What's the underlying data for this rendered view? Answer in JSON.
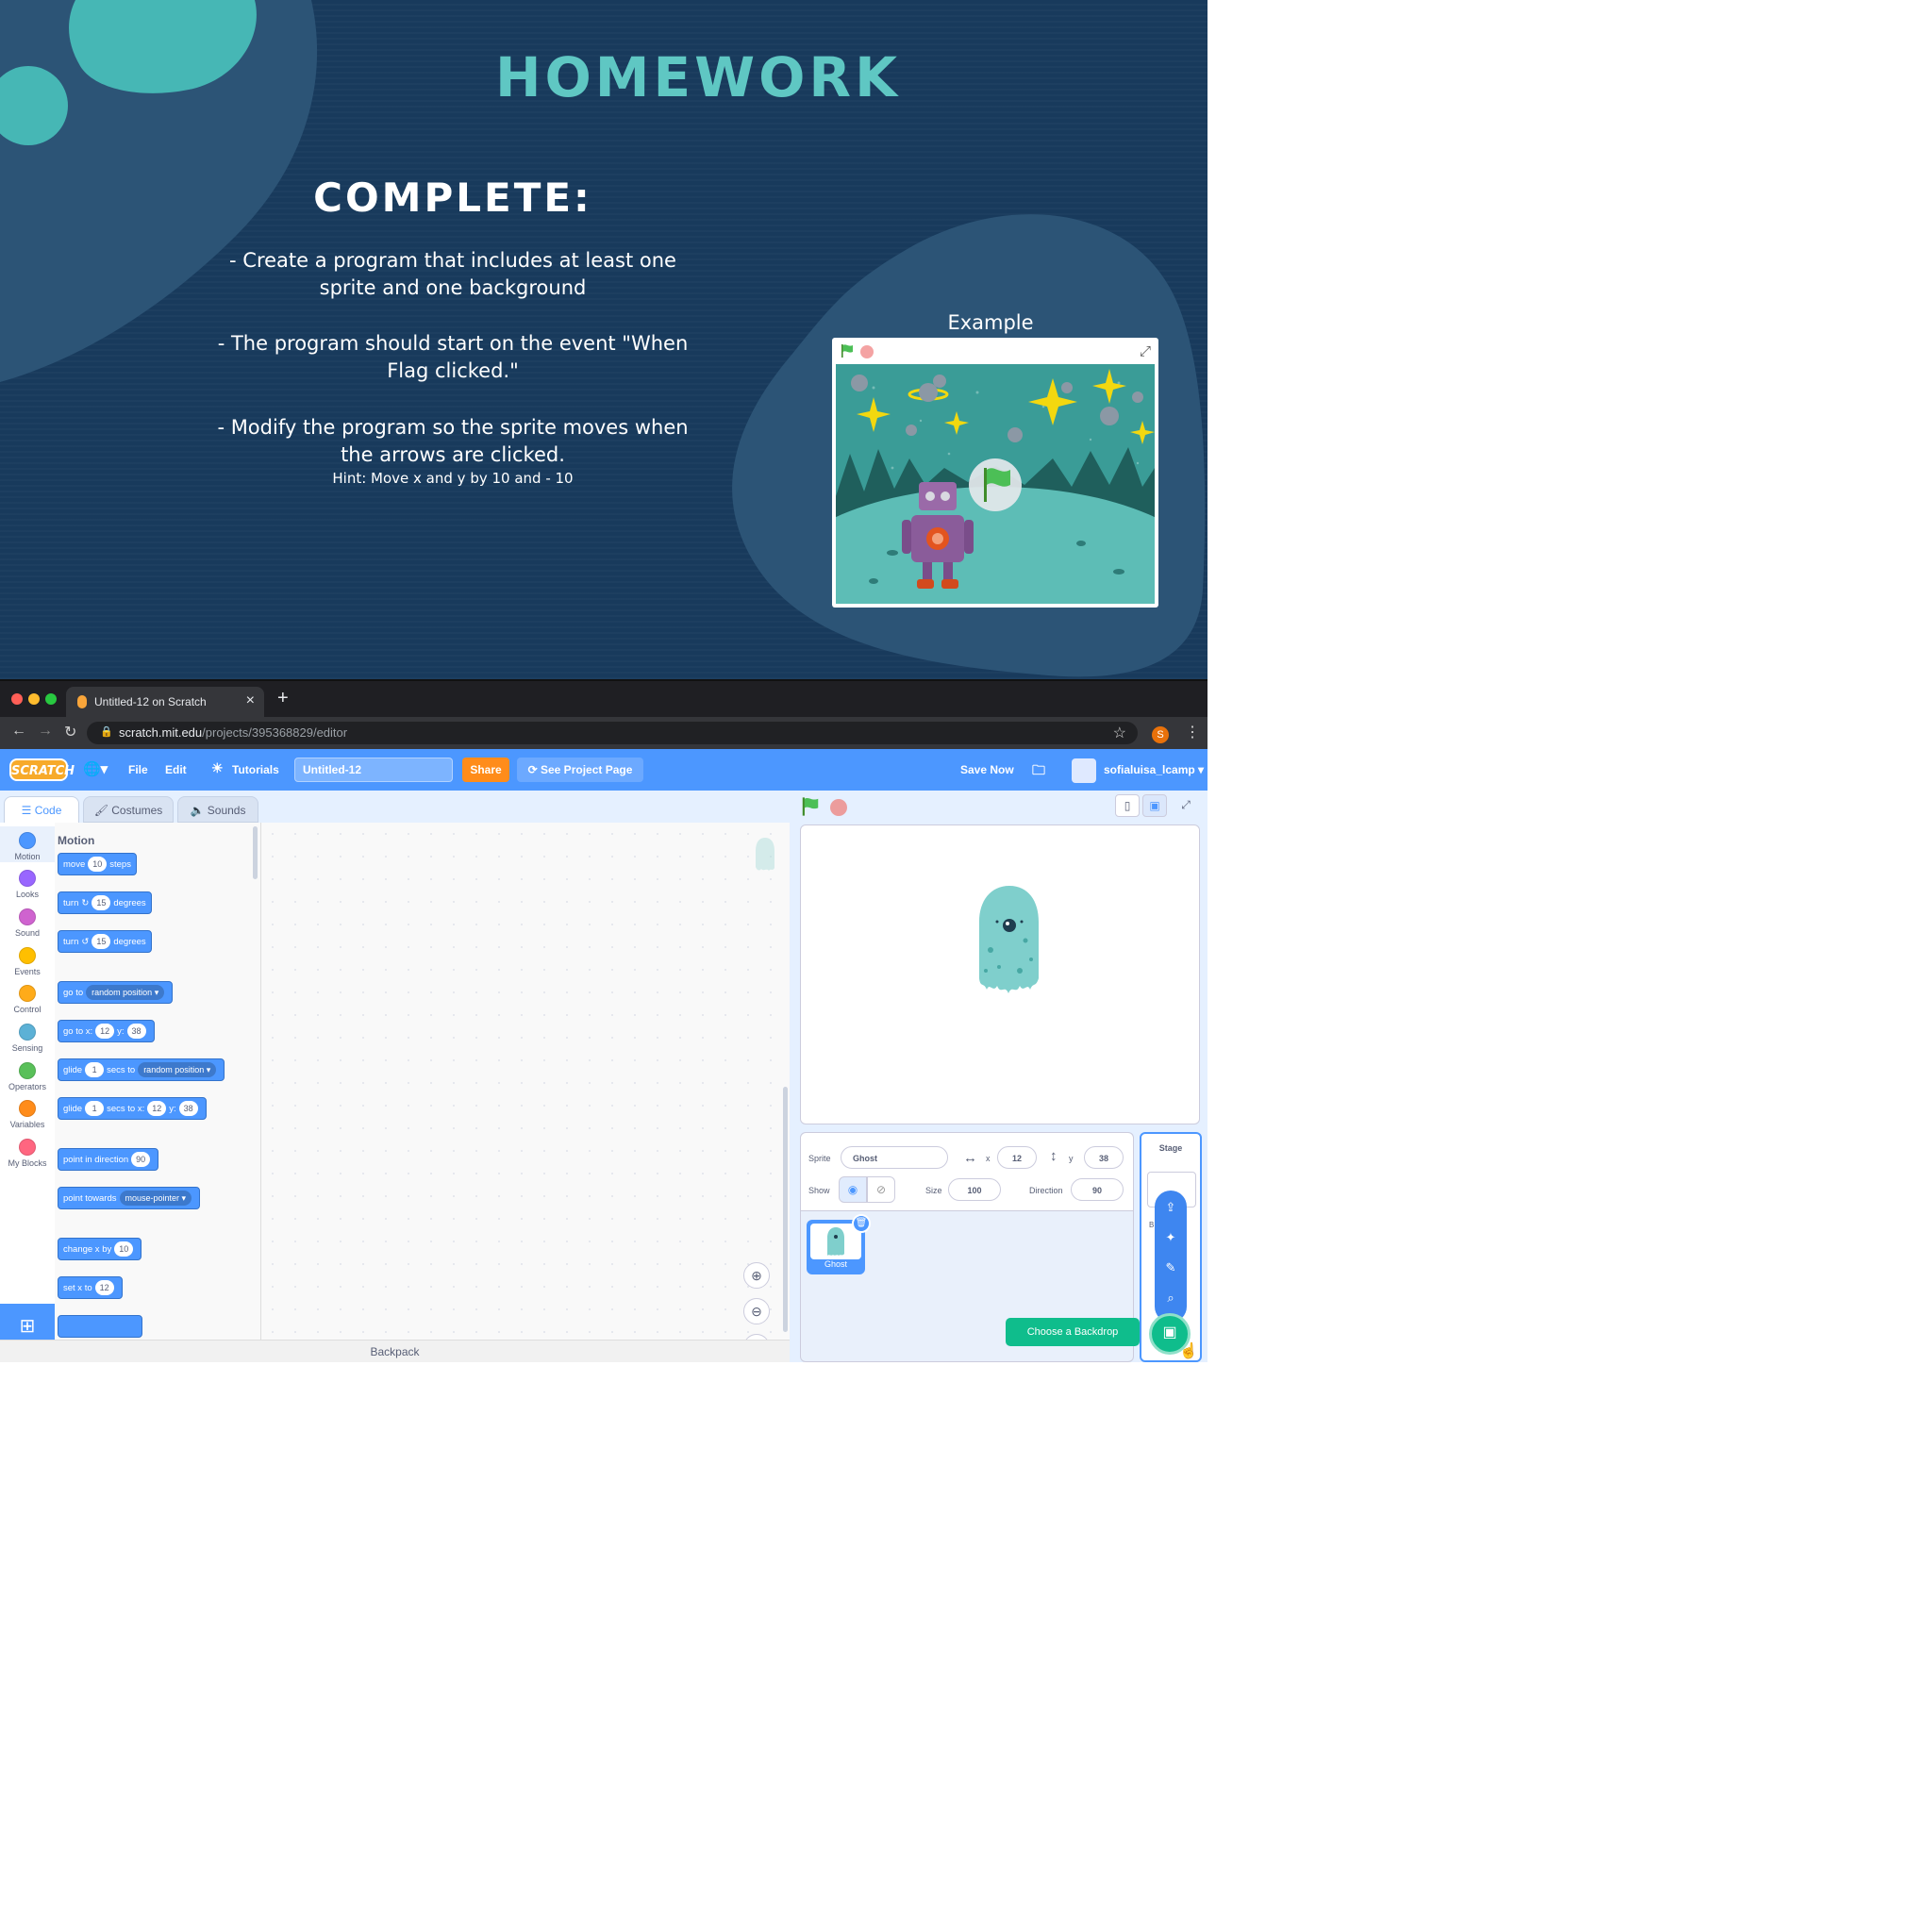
{
  "slide": {
    "title": "HOMEWORK",
    "heading": "COMPLETE:",
    "bullets": [
      "- Create a program that includes at least one sprite and one background",
      "- The program should start on the event \"When Flag clicked.\"",
      "- Modify the program so the sprite moves when the arrows are clicked."
    ],
    "hint": "Hint: Move x and y by 10 and - 10",
    "example_label": "Example",
    "colors": {
      "background": "#183a5c",
      "accent": "#5fc7c3",
      "blob": "#2c5476"
    }
  },
  "browser": {
    "tab_title": "Untitled-12 on Scratch",
    "url_host": "scratch.mit.edu",
    "url_path": "/projects/395368829/editor",
    "profile_initial": "S"
  },
  "menubar": {
    "logo": "SCRATCH",
    "file": "File",
    "edit": "Edit",
    "tutorials": "Tutorials",
    "project_title": "Untitled-12",
    "share": "Share",
    "see_project_page": "See Project Page",
    "save_now": "Save Now",
    "username": "sofialuisa_lcamp"
  },
  "editor_tabs": {
    "code": "Code",
    "costumes": "Costumes",
    "sounds": "Sounds"
  },
  "categories": [
    {
      "label": "Motion",
      "color": "#4c97ff"
    },
    {
      "label": "Looks",
      "color": "#9966ff"
    },
    {
      "label": "Sound",
      "color": "#cf63cf"
    },
    {
      "label": "Events",
      "color": "#ffbf00"
    },
    {
      "label": "Control",
      "color": "#ffab19"
    },
    {
      "label": "Sensing",
      "color": "#5cb1d6"
    },
    {
      "label": "Operators",
      "color": "#59c059"
    },
    {
      "label": "Variables",
      "color": "#ff8c1a"
    },
    {
      "label": "My Blocks",
      "color": "#ff6680"
    }
  ],
  "palette": {
    "heading": "Motion",
    "move": {
      "a": "move",
      "n": "10",
      "b": "steps"
    },
    "turn_right": {
      "a": "turn",
      "n": "15",
      "b": "degrees"
    },
    "turn_left": {
      "a": "turn",
      "n": "15",
      "b": "degrees"
    },
    "goto_random": {
      "a": "go to",
      "dd": "random position"
    },
    "goto_xy": {
      "a": "go to x:",
      "x": "12",
      "b": "y:",
      "y": "38"
    },
    "glide_random": {
      "a": "glide",
      "n": "1",
      "b": "secs to",
      "dd": "random position"
    },
    "glide_xy": {
      "a": "glide",
      "n": "1",
      "b": "secs to x:",
      "x": "12",
      "c": "y:",
      "y": "38"
    },
    "point_dir": {
      "a": "point in direction",
      "n": "90"
    },
    "point_towards": {
      "a": "point towards",
      "dd": "mouse-pointer"
    },
    "change_x": {
      "a": "change x by",
      "n": "10"
    },
    "set_x": {
      "a": "set x to",
      "n": "12"
    }
  },
  "backpack": "Backpack",
  "sprite_info": {
    "sprite_label": "Sprite",
    "sprite_name": "Ghost",
    "x_label": "x",
    "x": "12",
    "y_label": "y",
    "y": "38",
    "show_label": "Show",
    "size_label": "Size",
    "size": "100",
    "direction_label": "Direction",
    "direction": "90"
  },
  "sprite_tile_name": "Ghost",
  "stage_pane": {
    "title": "Stage",
    "backdrops_partial": "B      s"
  },
  "choose_backdrop": "Choose a Backdrop"
}
